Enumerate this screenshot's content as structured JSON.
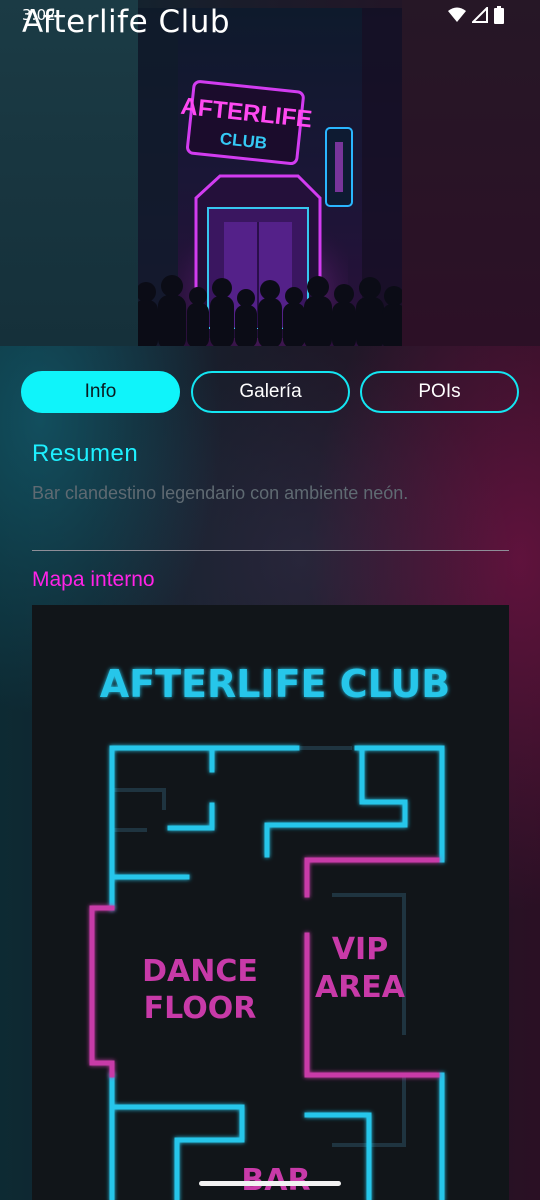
{
  "status_bar": {
    "time": "3:02",
    "icons": [
      "wifi-icon",
      "signal-icon",
      "battery-icon"
    ]
  },
  "header": {
    "title": "Afterlife Club"
  },
  "hero": {
    "sign_line1": "AFTERLIFE",
    "sign_line2": "CLUB"
  },
  "tabs": [
    {
      "label": "Info",
      "active": true
    },
    {
      "label": "Galería",
      "active": false
    },
    {
      "label": "POIs",
      "active": false
    }
  ],
  "summary": {
    "heading": "Resumen",
    "text": "Bar clandestino legendario con ambiente neón."
  },
  "map": {
    "heading": "Mapa interno",
    "title": "AFTERLIFE CLUB",
    "zones": {
      "dance_line1": "DANCE",
      "dance_line2": "FLOOR",
      "vip_line1": "VIP",
      "vip_line2": "AREA",
      "bar": "BAR"
    }
  },
  "colors": {
    "accent_cyan": "#0ff4fa",
    "accent_magenta": "#ff22e6",
    "map_cyan": "#27c6ea",
    "map_magenta": "#c83aa8"
  }
}
